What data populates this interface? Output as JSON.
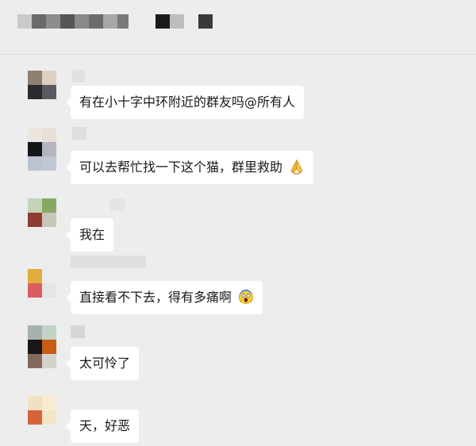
{
  "header": {
    "title": "",
    "title_blur_colors": [
      "#c9c9c9",
      "#6a6a6a",
      "#8d8d8d",
      "#555555",
      "#a7a7a7",
      "#7a7a7a",
      "#1a1a1a",
      "#3a3a3a"
    ]
  },
  "messages": [
    {
      "sender": "",
      "avatar_colors": [
        "#8e8074",
        "#ddd2c2",
        "#2b2b2d",
        "#595b60"
      ],
      "text": "有在小十字中环附近的群友吗@所有人",
      "emoji": ""
    },
    {
      "sender": "",
      "avatar_colors": [
        "#ece6e0",
        "#e8e0d8",
        "#151618",
        "#b3b5bf",
        "#bbc2d2",
        "#c3c6d4"
      ],
      "text": "可以去帮忙找一下这个猫，群里救助",
      "emoji": "folded-hands-emoji"
    },
    {
      "sender": "",
      "avatar_colors": [
        "#c5d3b8",
        "#86aa63",
        "#8f3c32",
        "#c8c6b8"
      ],
      "text": "我在",
      "emoji": ""
    },
    {
      "sender": "",
      "avatar_colors": [
        "#e2ad3c",
        "#ececec",
        "#dd5c62",
        "#e5e5e5"
      ],
      "text": "直接看不下去，得有多痛啊",
      "emoji": "screaming-face-emoji"
    },
    {
      "sender": "",
      "avatar_colors": [
        "#a8b1ad",
        "#c2d2c7",
        "#171717",
        "#c55e12",
        "#836a5c",
        "#d5d2ce"
      ],
      "text": "太可怜了",
      "emoji": ""
    },
    {
      "sender": "",
      "avatar_colors": [
        "#f0e2c1",
        "#f6ecd0",
        "#d6643a",
        "#f3e6c6"
      ],
      "text": "天，好恶",
      "emoji": ""
    }
  ]
}
